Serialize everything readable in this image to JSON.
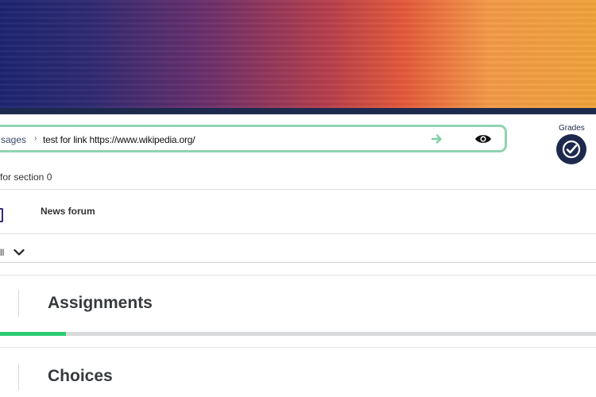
{
  "banner": {
    "colors": [
      "#1d2470",
      "#b63e4c",
      "#e45a3a",
      "#f0a23a"
    ]
  },
  "breadcrumb": {
    "item1": "sages",
    "separator": "›",
    "item2": "test for link https://www.wikipedia.org/"
  },
  "icons": {
    "go": "arrow-right-icon",
    "view": "eye-icon",
    "grades": "check-circle-icon"
  },
  "grades": {
    "label": "Grades"
  },
  "section": {
    "description": "for section 0"
  },
  "activity": {
    "title": "News forum"
  },
  "collapse": {
    "label": "ll"
  },
  "sections": [
    {
      "title": "Assignments",
      "progress": 0.11
    },
    {
      "title": "Choices"
    }
  ],
  "colors": {
    "accent_green": "#8fd3b1",
    "navy": "#1d2a4d",
    "progress": "#2ecc71"
  }
}
